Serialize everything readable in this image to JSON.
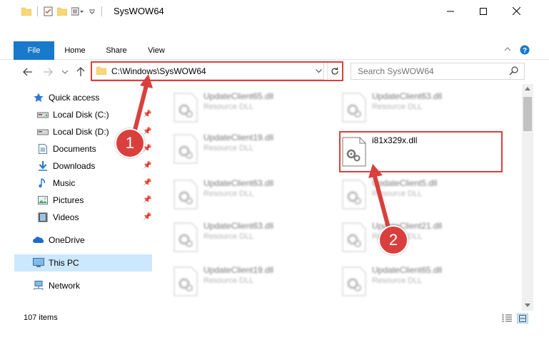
{
  "window": {
    "title": "SysWOW64",
    "controls": {
      "minimize": "—",
      "maximize": "☐",
      "close": "✕"
    }
  },
  "ribbon": {
    "tabs": [
      {
        "label": "File"
      },
      {
        "label": "Home"
      },
      {
        "label": "Share"
      },
      {
        "label": "View"
      }
    ]
  },
  "address": {
    "path": "C:\\Windows\\SysWOW64"
  },
  "search": {
    "placeholder": "Search SysWOW64"
  },
  "sidebar": {
    "items": [
      {
        "label": "Quick access",
        "icon": "star-icon"
      },
      {
        "label": "Local Disk (C:)",
        "icon": "drive-icon",
        "pinned": true
      },
      {
        "label": "Local Disk (D:)",
        "icon": "drive-icon",
        "pinned": true
      },
      {
        "label": "Documents",
        "icon": "documents-icon",
        "pinned": true
      },
      {
        "label": "Downloads",
        "icon": "downloads-icon",
        "pinned": true
      },
      {
        "label": "Music",
        "icon": "music-icon",
        "pinned": true
      },
      {
        "label": "Pictures",
        "icon": "pictures-icon",
        "pinned": true
      },
      {
        "label": "Videos",
        "icon": "videos-icon",
        "pinned": true
      },
      {
        "label": "OneDrive",
        "icon": "onedrive-icon"
      },
      {
        "label": "This PC",
        "icon": "pc-icon",
        "selected": true
      },
      {
        "label": "Network",
        "icon": "network-icon"
      }
    ]
  },
  "files": [
    {
      "name": "UpdateClient65.dll",
      "type": "Resource DLL"
    },
    {
      "name": "UpdateClient63.dll",
      "type": "Resource DLL"
    },
    {
      "name": "UpdateClient19.dll",
      "type": "Resource DLL"
    },
    {
      "name": "i81x329x.dll",
      "type": ""
    },
    {
      "name": "UpdateClient63.dll",
      "type": "Resource DLL"
    },
    {
      "name": "UpdateClient5.dll",
      "type": "Resource DLL"
    },
    {
      "name": "UpdateClient63.dll",
      "type": "Resource DLL"
    },
    {
      "name": "UpdateClient21.dll",
      "type": "Resource DLL"
    },
    {
      "name": "UpdateClient19.dll",
      "type": "Resource DLL"
    },
    {
      "name": "UpdateClient65.dll",
      "type": "Resource DLL"
    }
  ],
  "status": {
    "item_count": "107 items"
  },
  "annotations": {
    "step1": "1",
    "step2": "2"
  },
  "colors": {
    "accent": "#1979ca",
    "highlight": "#d9403d",
    "selected": "#cce8ff"
  }
}
